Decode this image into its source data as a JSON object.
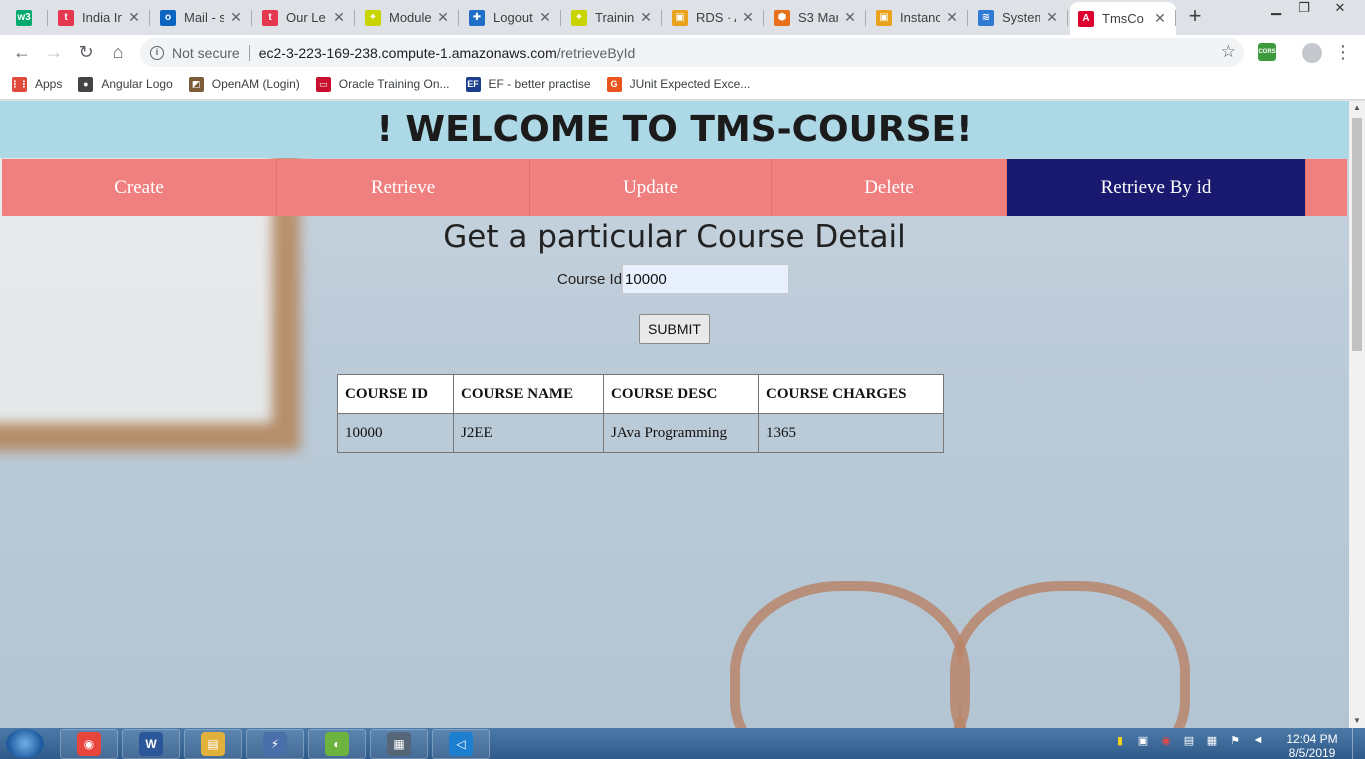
{
  "browser": {
    "tabs": [
      {
        "title": "",
        "icon": "w3schools-icon",
        "color": "#04aa6d",
        "glyph": "w3"
      },
      {
        "title": "India In",
        "icon": "tistory-icon",
        "color": "#e5374d",
        "glyph": "t"
      },
      {
        "title": "Mail - s",
        "icon": "outlook-icon",
        "color": "#0a64c0",
        "glyph": "o"
      },
      {
        "title": "Our Le",
        "icon": "tistory-icon",
        "color": "#e5374d",
        "glyph": "t"
      },
      {
        "title": "Module",
        "icon": "leaf-icon",
        "color": "#c7d400",
        "glyph": "✦"
      },
      {
        "title": "Logout",
        "icon": "jira-icon",
        "color": "#1f6fc9",
        "glyph": "✚"
      },
      {
        "title": "Trainin",
        "icon": "leaf-icon",
        "color": "#c7d400",
        "glyph": "✦"
      },
      {
        "title": "RDS · A",
        "icon": "aws-box-icon",
        "color": "#e8a21b",
        "glyph": "▣"
      },
      {
        "title": "S3 Mar",
        "icon": "aws-cube-icon",
        "color": "#e8701b",
        "glyph": "⬢"
      },
      {
        "title": "Instanc",
        "icon": "aws-box-icon",
        "color": "#e8a21b",
        "glyph": "▣"
      },
      {
        "title": "System",
        "icon": "layers-icon",
        "color": "#2f7ad3",
        "glyph": "≋"
      },
      {
        "title": "TmsCo",
        "icon": "angular-icon",
        "color": "#dd0031",
        "glyph": "A"
      }
    ],
    "address": {
      "not_secure": "Not secure",
      "host": "ec2-3-223-169-238.compute-1.amazonaws.com",
      "path": "/retrieveById"
    },
    "extension_label": "CORS",
    "bookmarks": [
      {
        "label": "Apps",
        "icon": "apps-grid-icon",
        "color": "#e04a3a",
        "glyph": "⋮⋮"
      },
      {
        "label": "Angular Logo",
        "icon": "globe-icon",
        "color": "#444444",
        "glyph": "●"
      },
      {
        "label": "OpenAM (Login)",
        "icon": "openam-icon",
        "color": "#7a5c3a",
        "glyph": "◩"
      },
      {
        "label": "Oracle Training On...",
        "icon": "oracle-icon",
        "color": "#c8102e",
        "glyph": "▭"
      },
      {
        "label": "EF - better practise",
        "icon": "ef-icon",
        "color": "#1a3e8c",
        "glyph": "EF"
      },
      {
        "label": "JUnit Expected Exce...",
        "icon": "junit-icon",
        "color": "#e8541b",
        "glyph": "G"
      }
    ]
  },
  "page": {
    "welcome": "! WELCOME TO TMS-COURSE!",
    "nav": [
      {
        "label": "Create",
        "width": 275
      },
      {
        "label": "Retrieve",
        "width": 253
      },
      {
        "label": "Update",
        "width": 242
      },
      {
        "label": "Delete",
        "width": 235
      },
      {
        "label": "Retrieve By id",
        "width": 299,
        "active": true
      }
    ],
    "heading": "Get a particular Course Detail",
    "form": {
      "label": "Course Id",
      "value": "10000",
      "submit": "SUBMIT"
    },
    "table": {
      "headers": [
        "COURSE ID",
        "COURSE NAME",
        "COURSE DESC",
        "COURSE CHARGES"
      ],
      "rows": [
        [
          "10000",
          "J2EE",
          "JAva Programming",
          "1365"
        ]
      ]
    }
  },
  "taskbar": {
    "apps": [
      {
        "icon": "chrome-icon",
        "color": "#e8453c",
        "glyph": "◉"
      },
      {
        "icon": "word-icon",
        "color": "#2b579a",
        "glyph": "W"
      },
      {
        "icon": "folder-icon",
        "color": "#e2b13c",
        "glyph": "▤"
      },
      {
        "icon": "network-tool-icon",
        "color": "#4a6ea8",
        "glyph": "⚡"
      },
      {
        "icon": "spring-icon",
        "color": "#6db33f",
        "glyph": "◐"
      },
      {
        "icon": "security-tool-icon",
        "color": "#556677",
        "glyph": "▦"
      },
      {
        "icon": "vscode-icon",
        "color": "#1e7fd1",
        "glyph": "◁"
      }
    ],
    "clock_time": "12:04 PM",
    "clock_date": "8/5/2019"
  }
}
